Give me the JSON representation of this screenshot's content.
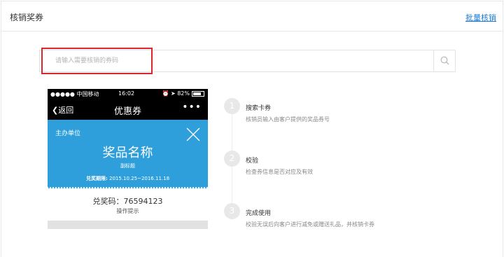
{
  "header": {
    "title": "核销奖券",
    "batch_link": "批量核销"
  },
  "search": {
    "placeholder": "请输入需要核销的券码",
    "value": ""
  },
  "phone": {
    "status": {
      "carrier": "●●●●● 中国移动",
      "time": "16:02",
      "battery": "82%",
      "battery_level": 0.82
    },
    "nav": {
      "back": "返回",
      "title": "优惠券",
      "more": "•••"
    },
    "coupon": {
      "organizer": "主办单位",
      "prize_name": "奖品名称",
      "subtitle": "副标题",
      "period_label": "兑奖期限:",
      "period_value": "2015.10.25~2016.11.18"
    },
    "code_label": "兑奖码：",
    "code_value": "76594123",
    "hint": "操作提示"
  },
  "steps": [
    {
      "num": "1",
      "title": "搜索卡券",
      "desc": "核销员输入由客户提供的奖品券号"
    },
    {
      "num": "2",
      "title": "校验",
      "desc": "检查券信息是否对应及有效"
    },
    {
      "num": "3",
      "title": "完成使用",
      "desc": "校验无误后向客户进行减免或赠送礼品，并核销卡券"
    }
  ],
  "colors": {
    "link": "#1a7ad9",
    "coupon_bg": "#2e9fdb",
    "highlight": "#e0262a",
    "step_circle": "#e8e8e8"
  }
}
